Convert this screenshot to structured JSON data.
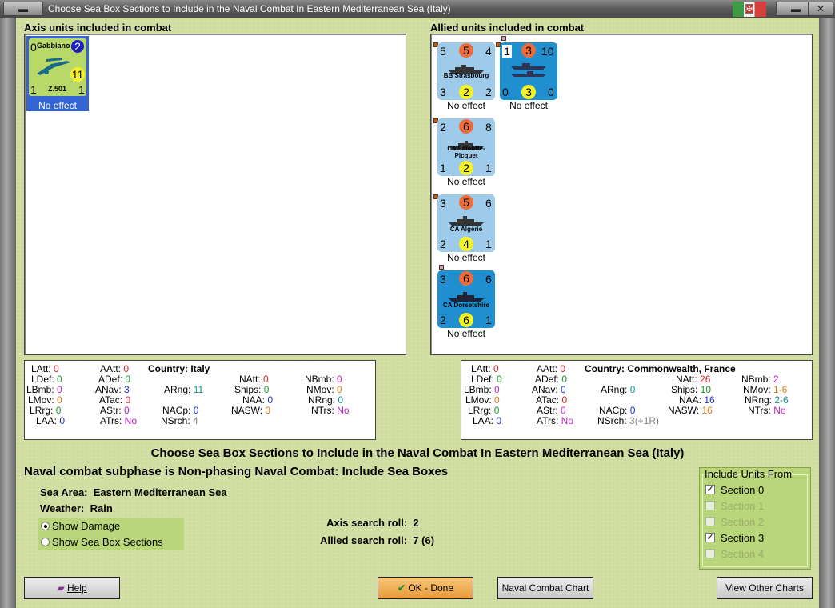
{
  "window": {
    "title": "Choose Sea Box Sections to Include in the Naval Combat In Eastern Mediterranean Sea (Italy)",
    "flag_symbol": "✠"
  },
  "axis": {
    "heading": "Axis units included in combat",
    "units": [
      {
        "name": "Z.501",
        "label": "Gabbiano",
        "top_left": "0",
        "top_right": "2",
        "bottom_left": "1",
        "bottom_right": "1",
        "mid_right": "11",
        "status": "No effect"
      }
    ]
  },
  "allied": {
    "heading": "Allied units included in combat",
    "units": [
      {
        "name": "BB Strasbourg",
        "top_left": "5",
        "top_mid": "5",
        "top_right": "4",
        "bottom_left": "3",
        "bottom_mid": "2",
        "bottom_right": "2",
        "status": "No effect"
      },
      {
        "name": "",
        "top_left": "1",
        "top_mid": "3",
        "top_right": "10",
        "bottom_left": "0",
        "bottom_mid": "3",
        "bottom_right": "0",
        "status": "No effect"
      },
      {
        "name": "CA Lamotte-Picquet",
        "top_left": "2",
        "top_mid": "6",
        "top_right": "8",
        "bottom_left": "1",
        "bottom_mid": "2",
        "bottom_right": "1",
        "status": "No effect"
      },
      {
        "name": "CA Algérie",
        "top_left": "3",
        "top_mid": "5",
        "top_right": "6",
        "bottom_left": "2",
        "bottom_mid": "4",
        "bottom_right": "1",
        "status": "No effect"
      },
      {
        "name": "CA Dorsetshire",
        "top_left": "3",
        "top_mid": "6",
        "top_right": "6",
        "bottom_left": "2",
        "bottom_mid": "6",
        "bottom_right": "1",
        "status": "No effect"
      }
    ]
  },
  "axis_stats": {
    "country_label": "Country:",
    "country": "Italy",
    "latt": "0",
    "ldef": "0",
    "lbmb": "0",
    "lmov": "0",
    "lrrg": "0",
    "laa": "0",
    "aatt": "0",
    "adef": "0",
    "anav": "3",
    "atac": "0",
    "astr": "0",
    "atrs": "No",
    "arng": "11",
    "nacp": "0",
    "nsrch": "4",
    "natt": "0",
    "ships": "0",
    "naa": "0",
    "nasw": "3",
    "nbmb": "0",
    "nmov": "0",
    "nrng": "0",
    "ntrs": "No"
  },
  "allied_stats": {
    "country_label": "Country:",
    "country": "Commonwealth, France",
    "latt": "0",
    "ldef": "0",
    "lbmb": "0",
    "lmov": "0",
    "lrrg": "0",
    "laa": "0",
    "aatt": "0",
    "adef": "0",
    "anav": "0",
    "atac": "0",
    "astr": "0",
    "atrs": "No",
    "arng": "0",
    "nacp": "0",
    "nsrch": "3(+1R)",
    "natt": "26",
    "ships": "10",
    "naa": "16",
    "nasw": "16",
    "nbmb": "2",
    "nmov": "1-6",
    "nrng": "2-6",
    "ntrs": "No"
  },
  "main": {
    "title": "Choose Sea Box Sections to Include in the Naval Combat In Eastern Mediterranean Sea (Italy)",
    "subtitle": "Naval combat subphase is Non-phasing Naval Combat: Include Sea Boxes",
    "sea_area_label": "Sea Area:",
    "sea_area": "Eastern Mediterranean Sea",
    "weather_label": "Weather:",
    "weather": "Rain",
    "show_damage": "Show Damage",
    "show_sections": "Show Sea Box Sections",
    "axis_roll_label": "Axis search roll:",
    "axis_roll": "2",
    "allied_roll_label": "Allied search roll:",
    "allied_roll": "7 (6)"
  },
  "include": {
    "legend": "Include Units From",
    "sections": [
      {
        "label": "Section 0",
        "checked": true,
        "enabled": true
      },
      {
        "label": "Section 1",
        "checked": false,
        "enabled": false
      },
      {
        "label": "Section 2",
        "checked": false,
        "enabled": false
      },
      {
        "label": "Section 3",
        "checked": true,
        "enabled": true
      },
      {
        "label": "Section 4",
        "checked": false,
        "enabled": false
      }
    ]
  },
  "buttons": {
    "help": "Help",
    "ok": "OK - Done",
    "chart": "Naval Combat Chart",
    "other": "View Other Charts"
  },
  "colors": {
    "counter_light": "#9ecbe9",
    "counter_dark": "#1f8fcf",
    "axis_counter": "#b8d86a",
    "orange_circle": "#ee6b3a",
    "yellow_circle": "#f5f227"
  }
}
